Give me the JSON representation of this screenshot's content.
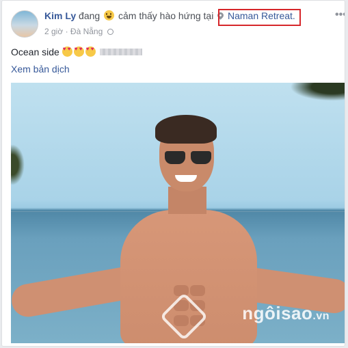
{
  "post": {
    "author": "Kim Ly",
    "header_prefix": "đang",
    "feeling": "cảm thấy hào hứng tại",
    "place": "Naman Retreat.",
    "time": "2 giờ",
    "location": "Đà Nẵng",
    "separator": "·",
    "status_text": "Ocean side",
    "translate_label": "Xem bản dịch",
    "more_label": "•••",
    "emoji_happy": "happy-face-icon",
    "emoji_heart_eyes": "heart-eyes-icon"
  },
  "watermark": {
    "text": "ngôisao",
    "suffix": ".vn"
  },
  "colors": {
    "link": "#365899",
    "highlight_box": "#d6262a",
    "meta": "#90949c"
  }
}
